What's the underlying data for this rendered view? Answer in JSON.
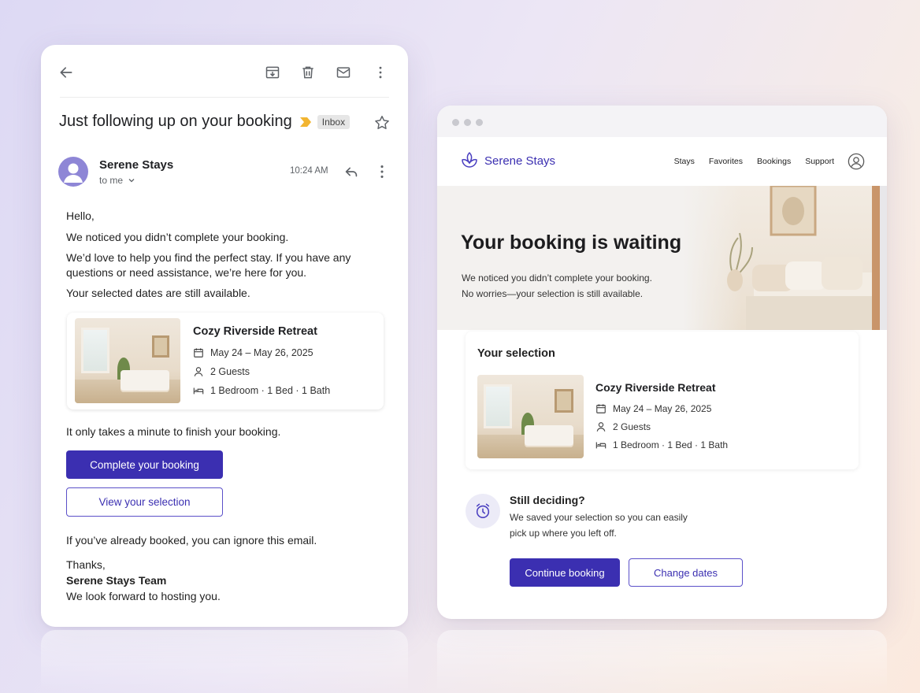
{
  "email": {
    "subject": "Just following up on your booking",
    "label": "Inbox",
    "sender_name": "Serene Stays",
    "recipient": "to me",
    "time": "10:24 AM",
    "body": {
      "greeting": "Hello,",
      "p1": "We noticed you didn’t complete your booking.",
      "p2": "We’d love to help you find the perfect stay. If you have any questions or need assistance, we’re here for you.",
      "p3": "Your selected dates are still available.",
      "p4": "It only takes a minute to finish your booking.",
      "p5": "If you’ve already booked, you can ignore this email.",
      "signoff": "Thanks,",
      "team": "Serene Stays Team",
      "closing": "We look forward to hosting you."
    },
    "property": {
      "name": "Cozy Riverside Retreat",
      "dates": "May 24 – May 26, 2025",
      "guests": "2 Guests",
      "rooms": "1 Bedroom · 1 Bed · 1 Bath"
    },
    "buttons": {
      "primary": "Complete your booking",
      "secondary": "View your selection"
    },
    "icons": [
      "back-arrow-icon",
      "archive-icon",
      "trash-icon",
      "mail-icon",
      "more-vert-icon",
      "star-icon",
      "reply-icon"
    ]
  },
  "site": {
    "brand": "Serene Stays",
    "nav": [
      "Stays",
      "Favorites",
      "Bookings",
      "Support"
    ],
    "hero_title": "Your booking is waiting",
    "hero_line1": "We noticed you didn’t complete your booking.",
    "hero_line2": "No worries—your selection is still available.",
    "selection_heading": "Your selection",
    "property": {
      "name": "Cozy Riverside Retreat",
      "dates": "May 24 – May 26, 2025",
      "guests": "2 Guests",
      "rooms": "1 Bedroom · 1 Bed · 1 Bath"
    },
    "still_deciding_title": "Still deciding?",
    "still_deciding_text": "We saved your selection so you can easily pick up where you left off.",
    "buttons": {
      "primary": "Continue booking",
      "secondary": "Change dates"
    }
  },
  "colors": {
    "accent": "#3b2fb1",
    "importance_marker": "#f2b531",
    "avatar": "#8e86d6"
  }
}
